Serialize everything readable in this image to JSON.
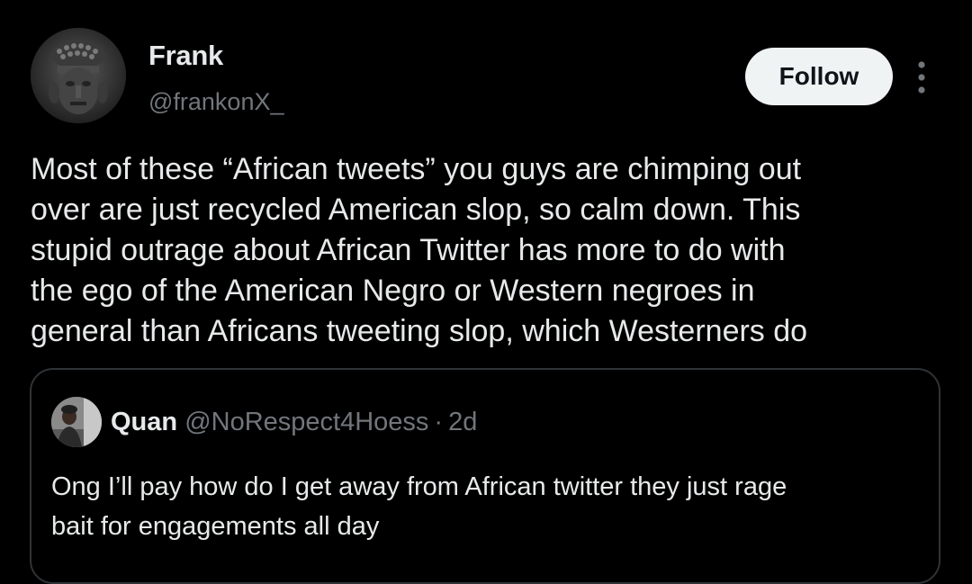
{
  "tweet": {
    "author": {
      "display_name": "Frank",
      "handle": "@frankonX_",
      "avatar_icon": "sculpture-avatar"
    },
    "follow_label": "Follow",
    "more_icon": "more-vertical-icon",
    "text_lines": [
      "Most of these “African tweets” you guys are chimping out",
      "over are just recycled American slop, so calm down. This",
      "stupid outrage about African Twitter has more to do with",
      "the ego of the American Negro or Western negroes in",
      "general than Africans tweeting slop, which Westerners do"
    ]
  },
  "quote": {
    "display_name": "Quan",
    "handle": "@NoRespect4Hoess",
    "separator": "·",
    "time": "2d",
    "avatar_icon": "person-avatar",
    "text_lines": [
      "Ong I’ll pay how do I get away from African twitter they just rage",
      "bait for engagements all day"
    ]
  },
  "colors": {
    "background": "#000000",
    "primary_text": "#e7e9ea",
    "secondary_text": "#71767b",
    "border": "#2f3336",
    "follow_button_bg": "#eff3f4",
    "follow_button_text": "#0f1419"
  }
}
